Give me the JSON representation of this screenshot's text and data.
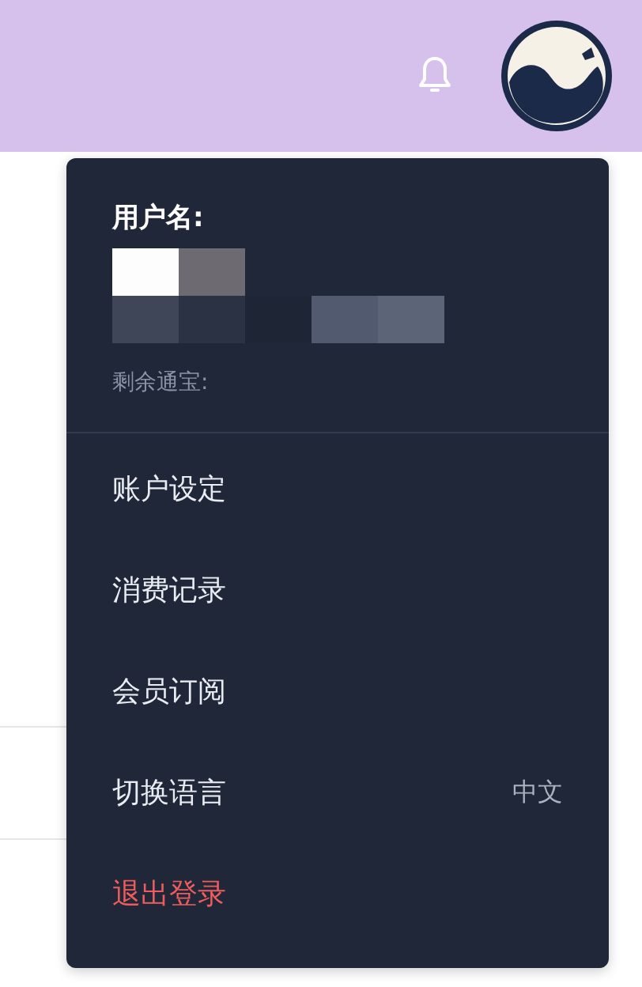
{
  "menu": {
    "username_label": "用户名:",
    "balance_label": "剩余通宝:",
    "items": [
      {
        "label": "账户设定",
        "kind": "normal"
      },
      {
        "label": "消费记录",
        "kind": "normal"
      },
      {
        "label": "会员订阅",
        "kind": "normal"
      },
      {
        "label": "切换语言",
        "kind": "normal",
        "value": "中文"
      },
      {
        "label": "退出登录",
        "kind": "danger"
      }
    ]
  }
}
